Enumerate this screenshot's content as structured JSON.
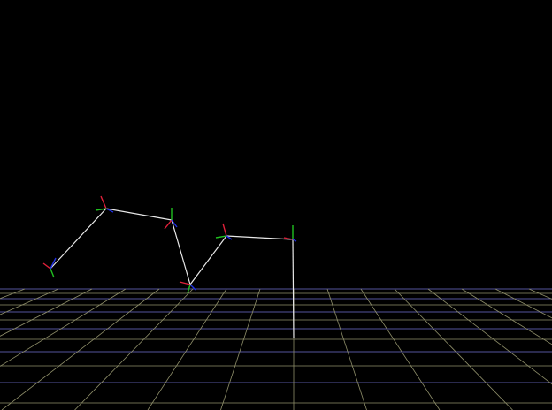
{
  "scene": {
    "background_color": "#000000",
    "grid_color": "#8f8f6a",
    "grid_accent_color": "#6f6fd0",
    "bone_color": "#e8e8e8",
    "axis_colors": {
      "x": "#e0203a",
      "y": "#20c020",
      "z": "#2030e0"
    }
  }
}
